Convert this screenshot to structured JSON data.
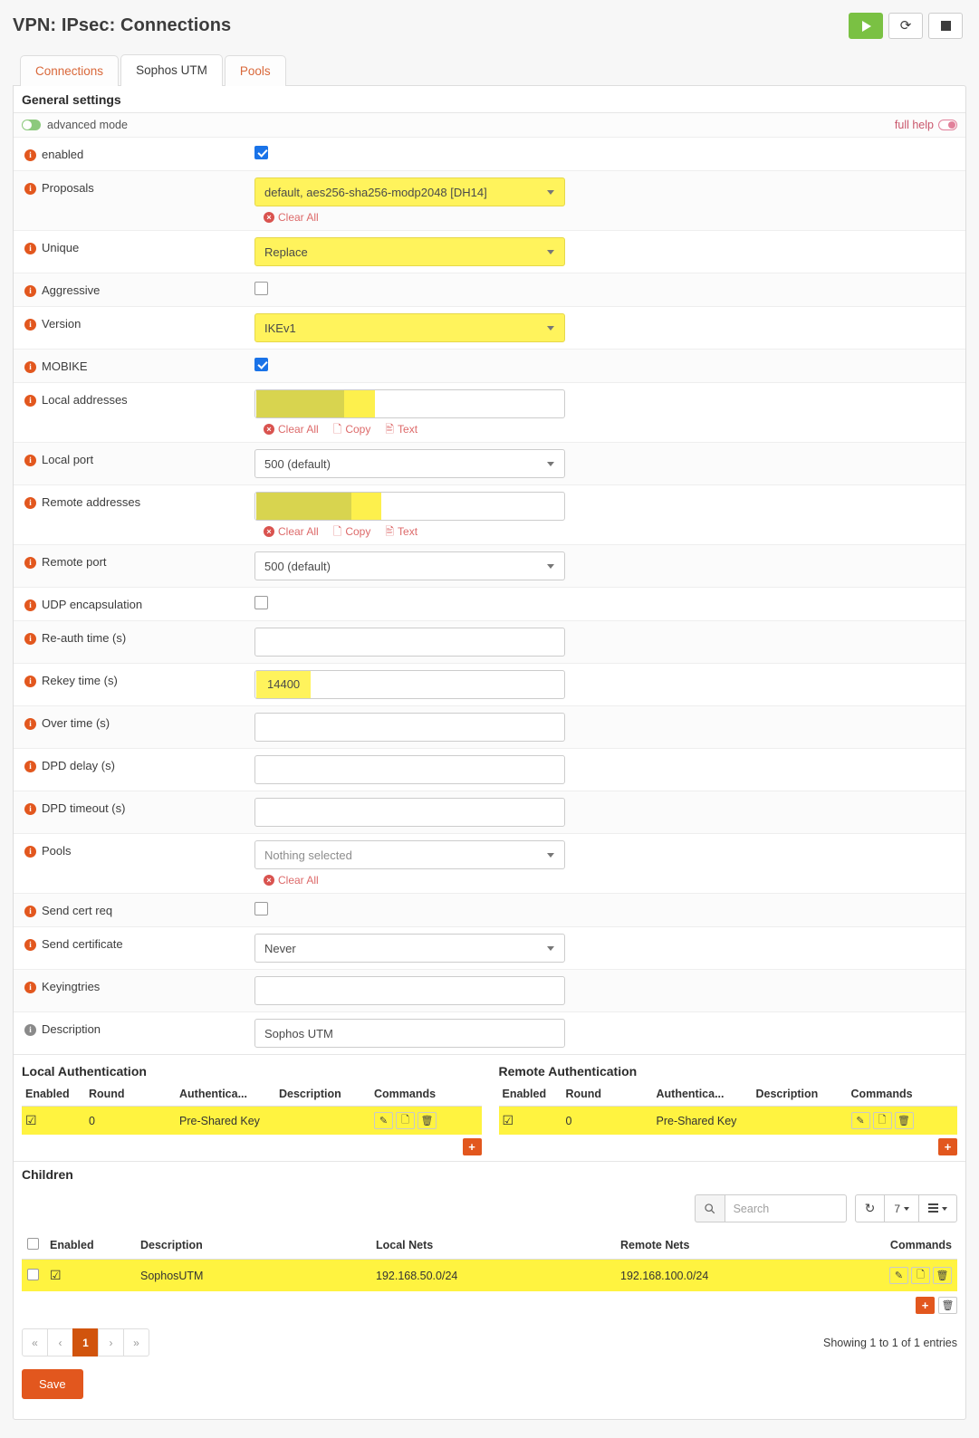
{
  "header": {
    "title": "VPN: IPsec: Connections",
    "buttons": [
      {
        "name": "start",
        "icon": "play-icon"
      },
      {
        "name": "reload",
        "icon": "refresh-icon",
        "glyph": "⟳"
      },
      {
        "name": "stop",
        "icon": "stop-icon"
      }
    ]
  },
  "tabs": [
    {
      "label": "Connections",
      "active": false
    },
    {
      "label": "Sophos UTM",
      "active": true
    },
    {
      "label": "Pools",
      "active": false
    }
  ],
  "general": {
    "section_title": "General settings",
    "advanced_mode_label": "advanced mode",
    "full_help_label": "full help",
    "clear_all_label": "Clear All",
    "copy_label": "Copy",
    "text_label": "Text",
    "fields": {
      "enabled": {
        "label": "enabled",
        "checked": true
      },
      "proposals": {
        "label": "Proposals",
        "value": "default, aes256-sha256-modp2048 [DH14]"
      },
      "unique": {
        "label": "Unique",
        "value": "Replace"
      },
      "aggressive": {
        "label": "Aggressive",
        "checked": false
      },
      "version": {
        "label": "Version",
        "value": "IKEv1"
      },
      "mobike": {
        "label": "MOBIKE",
        "checked": true
      },
      "local_addresses": {
        "label": "Local addresses",
        "value": ""
      },
      "local_port": {
        "label": "Local port",
        "value": "500 (default)"
      },
      "remote_addresses": {
        "label": "Remote addresses",
        "value": ""
      },
      "remote_port": {
        "label": "Remote port",
        "value": "500 (default)"
      },
      "udp_encapsulation": {
        "label": "UDP encapsulation",
        "checked": false
      },
      "reauth_time": {
        "label": "Re-auth time (s)",
        "value": ""
      },
      "rekey_time": {
        "label": "Rekey time (s)",
        "value": "14400"
      },
      "over_time": {
        "label": "Over time (s)",
        "value": ""
      },
      "dpd_delay": {
        "label": "DPD delay (s)",
        "value": ""
      },
      "dpd_timeout": {
        "label": "DPD timeout (s)",
        "value": ""
      },
      "pools": {
        "label": "Pools",
        "value": "Nothing selected"
      },
      "send_cert_req": {
        "label": "Send cert req",
        "checked": false
      },
      "send_certificate": {
        "label": "Send certificate",
        "value": "Never"
      },
      "keyingtries": {
        "label": "Keyingtries",
        "value": ""
      },
      "description": {
        "label": "Description",
        "value": "Sophos UTM"
      }
    }
  },
  "local_auth": {
    "title": "Local Authentication",
    "columns": [
      "Enabled",
      "Round",
      "Authentica...",
      "Description",
      "Commands"
    ],
    "rows": [
      {
        "enabled": true,
        "round": "0",
        "authentication": "Pre-Shared Key",
        "description": ""
      }
    ]
  },
  "remote_auth": {
    "title": "Remote Authentication",
    "columns": [
      "Enabled",
      "Round",
      "Authentica...",
      "Description",
      "Commands"
    ],
    "rows": [
      {
        "enabled": true,
        "round": "0",
        "authentication": "Pre-Shared Key",
        "description": ""
      }
    ]
  },
  "children": {
    "title": "Children",
    "search_placeholder": "Search",
    "search_value": "",
    "page_size": "7",
    "columns": [
      "Enabled",
      "Description",
      "Local Nets",
      "Remote Nets",
      "Commands"
    ],
    "rows": [
      {
        "selected": false,
        "enabled": true,
        "description": "SophosUTM",
        "local_nets": "192.168.50.0/24",
        "remote_nets": "192.168.100.0/24"
      }
    ],
    "pagination": {
      "first": "«",
      "prev": "‹",
      "current": "1",
      "next": "›",
      "last": "»"
    },
    "showing": "Showing 1 to 1 of 1 entries"
  },
  "footer": {
    "save_label": "Save"
  },
  "colors": {
    "accent_orange": "#e2571e",
    "highlight_yellow": "#fff35c",
    "row_highlight": "#fff340",
    "green": "#7ac143",
    "link_red": "#d9683a"
  }
}
